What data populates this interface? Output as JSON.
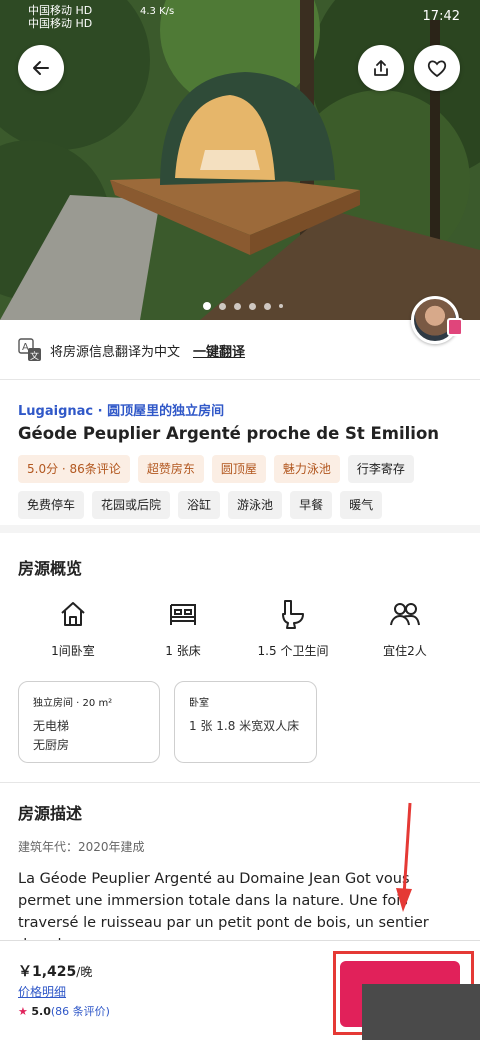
{
  "status_bar": {
    "carrier1": "中国移动 HD",
    "carrier2": "中国移动 HD",
    "net_speed": "4.3 K/s",
    "time": "17:42"
  },
  "hero": {
    "photo_dot_count": 6,
    "active_dot": 1,
    "back_icon": "arrow-left-icon",
    "share_icon": "share-icon",
    "save_icon": "heart-icon"
  },
  "translate": {
    "text": "将房源信息翻译为中文",
    "action": "一键翻译"
  },
  "listing": {
    "location": "Lugaignac · 圆顶屋里的独立房间",
    "title": "Géode Peuplier Argenté proche de St Emilion",
    "tags_row1": [
      {
        "label": "5.0分 · 86条评论",
        "highlight": true
      },
      {
        "label": "超赞房东",
        "highlight": true
      },
      {
        "label": "圆顶屋",
        "highlight": true
      },
      {
        "label": "魅力泳池",
        "highlight": true
      },
      {
        "label": "行李寄存",
        "highlight": false
      },
      {
        "label": "免费停车",
        "highlight": false
      }
    ],
    "tags_row2": [
      {
        "label": "花园或后院",
        "highlight": false
      },
      {
        "label": "浴缸",
        "highlight": false
      },
      {
        "label": "游泳池",
        "highlight": false
      },
      {
        "label": "早餐",
        "highlight": false
      },
      {
        "label": "暖气",
        "highlight": false
      }
    ]
  },
  "overview": {
    "title": "房源概览",
    "amenities": [
      {
        "label": "1间卧室",
        "icon": "house-icon"
      },
      {
        "label": "1 张床",
        "icon": "bed-icon"
      },
      {
        "label": "1.5 个卫生间",
        "icon": "toilet-icon"
      },
      {
        "label": "宜住2人",
        "icon": "guests-icon"
      }
    ],
    "card1": {
      "heading": "独立房间 · 20 m²",
      "line1": "无电梯",
      "line2": "无厨房"
    },
    "card2": {
      "heading": "卧室",
      "line1": "1 张 1.8 米宽双人床"
    }
  },
  "description": {
    "title": "房源描述",
    "year": "建筑年代：2020年建成",
    "text": "La Géode Peuplier Argenté au Domaine Jean Got vous permet une immersion totale dans la nature. Une fois traversé le ruisseau par un petit pont de bois, un sentier dans le..."
  },
  "booking": {
    "price": "￥1,425",
    "per": "/晚",
    "price_detail": "价格明细",
    "rating_value": "5.0",
    "rating_count": "(86 条评价)",
    "accent": "#e1215a"
  }
}
